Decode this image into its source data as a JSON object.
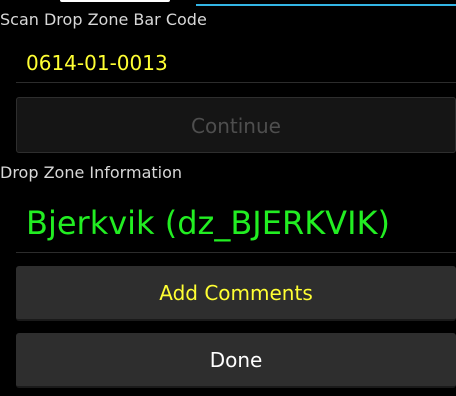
{
  "scan_section": {
    "label": "Scan Drop Zone Bar Code",
    "barcode_value": "0614-01-0013"
  },
  "continue_button": {
    "label": "Continue",
    "enabled": false
  },
  "dropzone_section": {
    "label": "Drop Zone Information",
    "value": "Bjerkvik (dz_BJERKVIK)"
  },
  "add_comments_button": {
    "label": "Add Comments"
  },
  "done_button": {
    "label": "Done"
  },
  "colors": {
    "background": "#000000",
    "accent": "#33b5e5",
    "barcode_text": "#ffff33",
    "dropzone_text": "#22ee22",
    "label_text": "#d8d8d8",
    "button_bg": "#2e2e2e",
    "disabled_text": "#4e4e4e"
  }
}
